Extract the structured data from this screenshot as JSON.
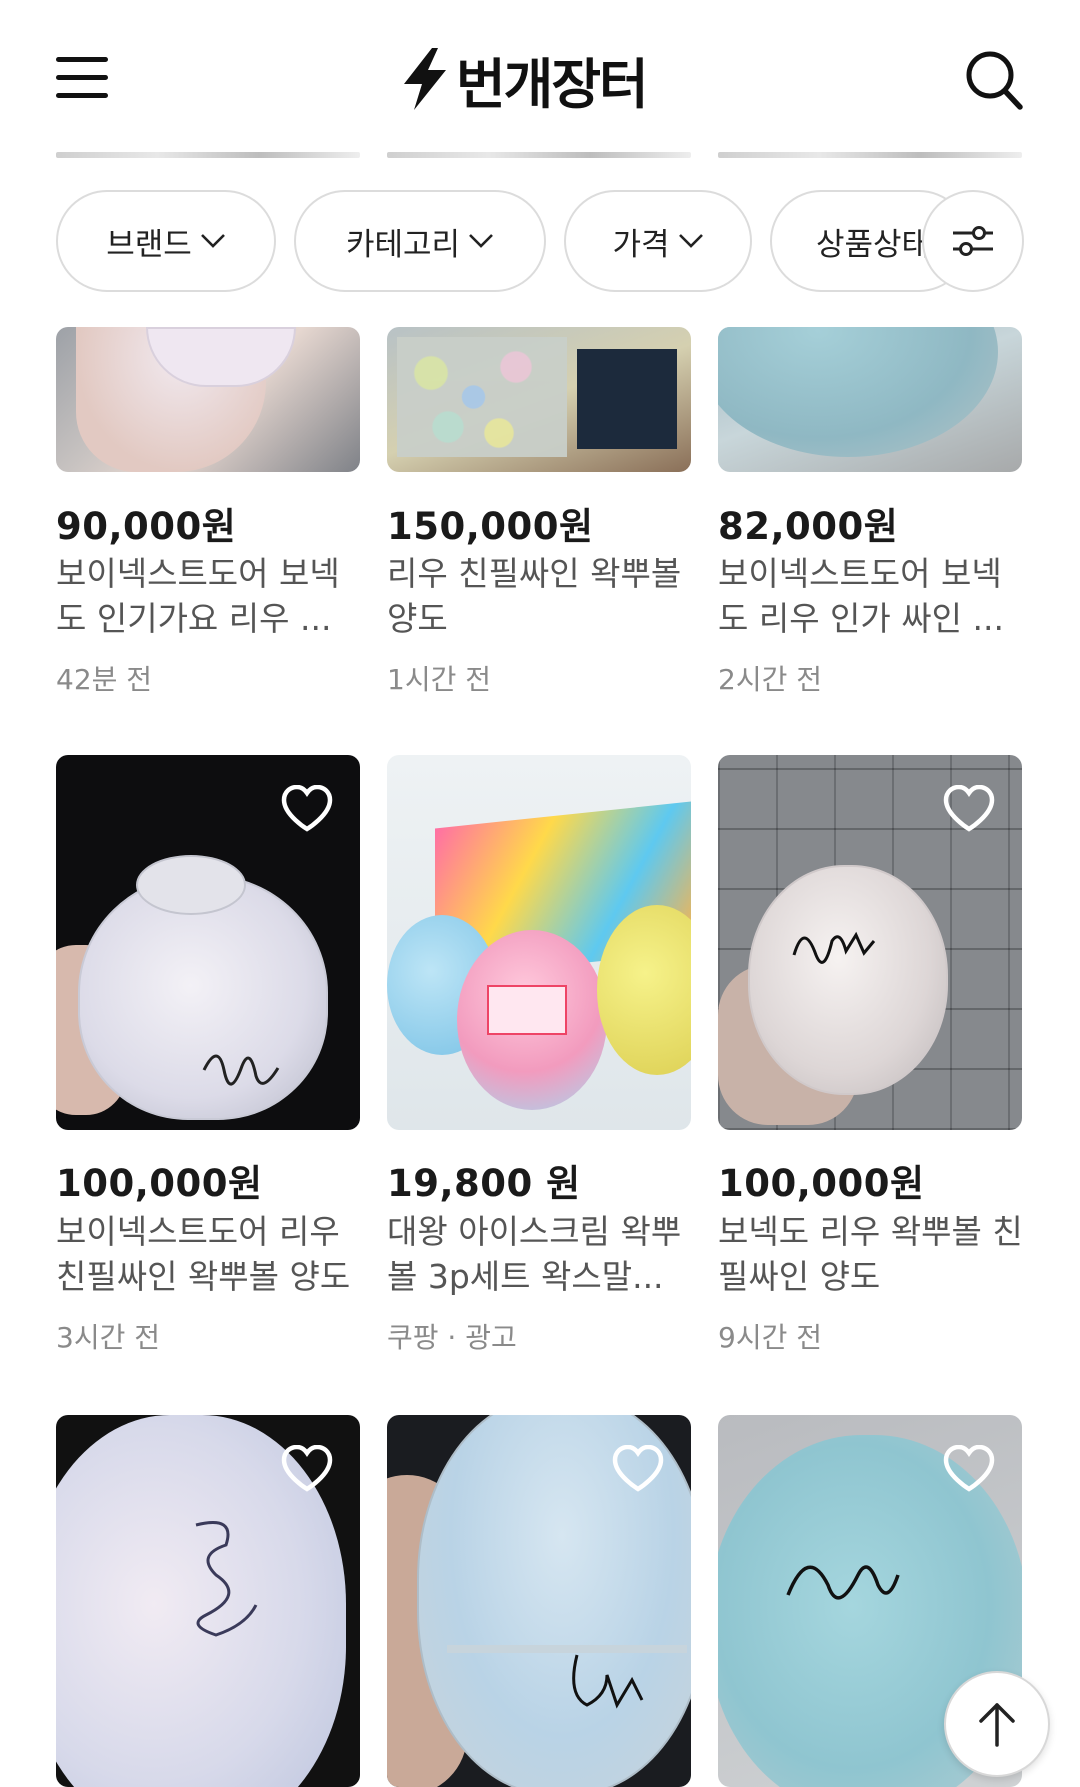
{
  "header": {
    "logo_text": "번개장터",
    "icons": {
      "menu": "hamburger-icon",
      "search": "search-icon",
      "logo": "lightning-icon"
    }
  },
  "filters": {
    "chips": [
      {
        "label": "브랜드"
      },
      {
        "label": "카테고리"
      },
      {
        "label": "가격"
      },
      {
        "label": "상품상태"
      }
    ],
    "settings_icon": "sliders-icon"
  },
  "products": [
    {
      "price": "90,000원",
      "title": "보이넥스트도어 보넥도 인기가요 리우 ...",
      "meta": "42분 전",
      "heart": false
    },
    {
      "price": "150,000원",
      "title": "리우 친필싸인 왁뿌볼 양도",
      "meta": "1시간 전",
      "heart": false
    },
    {
      "price": "82,000원",
      "title": "보이넥스트도어 보넥도 리우 인가 싸인 ...",
      "meta": "2시간 전",
      "heart": false
    },
    {
      "price": "100,000원",
      "title": "보이넥스트도어 리우 친필싸인 왁뿌볼 양도",
      "meta": "3시간 전",
      "heart": true
    },
    {
      "price": "19,800 원",
      "title": "대왕 아이스크림 왁뿌볼 3p세트 왁스말...",
      "meta": "쿠팡 · 광고",
      "heart": false
    },
    {
      "price": "100,000원",
      "title": "보넥도 리우 왁뿌볼 친필싸인 양도",
      "meta": "9시간 전",
      "heart": true
    },
    {
      "price": "",
      "title": "",
      "meta": "",
      "heart": true
    },
    {
      "price": "",
      "title": "",
      "meta": "",
      "heart": true
    },
    {
      "price": "",
      "title": "",
      "meta": "",
      "heart": true
    }
  ],
  "colors": {
    "text": "#1e1e1e",
    "muted": "#8a8a8a",
    "border": "#dcdcdc"
  },
  "scroll_top_icon": "arrow-up-icon"
}
